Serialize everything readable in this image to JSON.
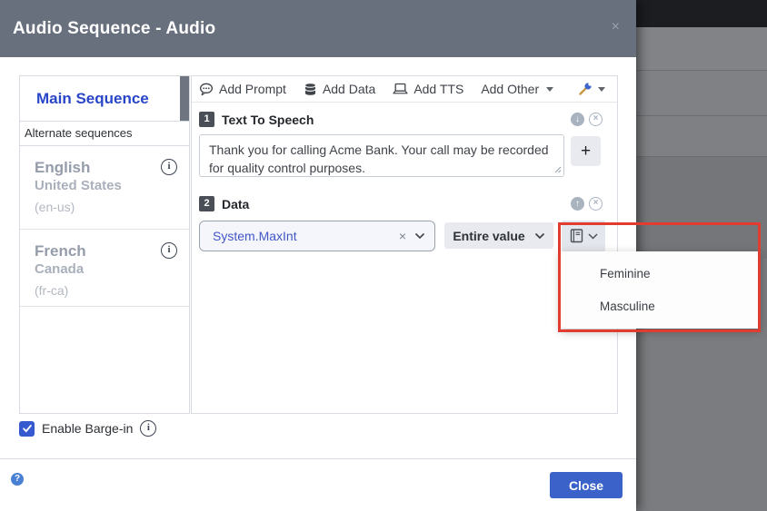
{
  "window": {
    "title": "Audio Sequence - Audio"
  },
  "sidebar": {
    "selected": "Main Sequence",
    "section_label": "Alternate sequences",
    "languages": [
      {
        "name": "English",
        "region": "United States",
        "code": "(en-us)"
      },
      {
        "name": "French",
        "region": "Canada",
        "code": "(fr-ca)"
      }
    ]
  },
  "toolbar": {
    "items": [
      {
        "label": "Add Prompt",
        "icon": "speech-bubble-icon"
      },
      {
        "label": "Add Data",
        "icon": "database-icon"
      },
      {
        "label": "Add TTS",
        "icon": "laptop-icon"
      },
      {
        "label": "Add Other",
        "icon": "chevron-down-icon"
      }
    ],
    "settings_icon": "wrench-icon"
  },
  "steps": [
    {
      "num": "1",
      "title": "Text To Speech",
      "tts_text": "Thank you for calling Acme Bank. Your call may be recorded for quality control purposes."
    },
    {
      "num": "2",
      "title": "Data",
      "variable": "System.MaxInt",
      "format": "Entire value"
    }
  ],
  "gender_menu": {
    "items": [
      "Feminine",
      "Masculine"
    ]
  },
  "barge_in": {
    "label": "Enable Barge-in",
    "checked": true
  },
  "footer": {
    "close": "Close"
  },
  "glyphs": {
    "close_x": "×",
    "plus": "+",
    "question": "?",
    "info": "i",
    "clear_x": "×",
    "arrow_down": "↓",
    "arrow_up": "↑",
    "x_small": "×"
  },
  "colors": {
    "header_gray": "#68707e",
    "accent_blue": "#2946c9",
    "button_blue": "#3a62c8",
    "checkbox_blue": "#3659cf",
    "annotation_red": "#e23b2f"
  }
}
